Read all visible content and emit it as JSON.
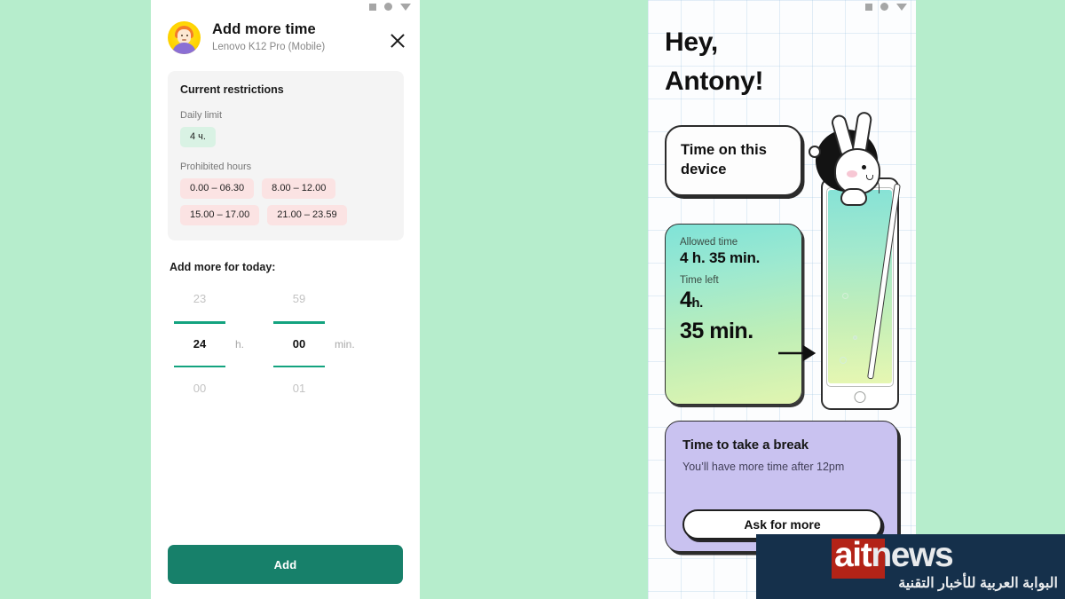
{
  "background_color": "#b6edcc",
  "left_panel": {
    "system_bar_icons": [
      "square-nav-icon",
      "circle-nav-icon",
      "triangle-back-icon"
    ],
    "avatar_name": "child-avatar",
    "title": "Add more time",
    "subtitle": "Lenovo K12 Pro (Mobile)",
    "close_icon": "close-icon",
    "restrictions": {
      "title": "Current restrictions",
      "daily_limit_label": "Daily limit",
      "daily_limit_value": "4 ч.",
      "prohibited_label": "Prohibited hours",
      "prohibited_hours": [
        "0.00 – 06.30",
        "8.00 – 12.00",
        "15.00 – 17.00",
        "21.00 – 23.59"
      ],
      "chip_green": "#d9f2e4",
      "chip_pink": "#fbe3e3"
    },
    "picker": {
      "section_label": "Add more for today:",
      "hours": {
        "above": "23",
        "value": "24",
        "below": "00",
        "unit": "h."
      },
      "minutes": {
        "above": "59",
        "value": "00",
        "below": "01",
        "unit": "min."
      },
      "rule_color": "#13a37f"
    },
    "add_button_label": "Add",
    "add_button_color": "#17806a"
  },
  "right_panel": {
    "system_bar_icons": [
      "square-nav-icon",
      "circle-nav-icon",
      "triangle-back-icon"
    ],
    "greeting_line1": "Hey,",
    "greeting_line2": "Antony!",
    "bubble_card_text": "Time on this device",
    "time_card": {
      "allowed_label": "Allowed time",
      "allowed_value": "4 h. 35 min.",
      "left_label": "Time left",
      "left_hours": "4",
      "left_hours_unit": "h.",
      "left_minutes": "35 min.",
      "gradient_from": "#7fe3d8",
      "gradient_to": "#e1f5b0"
    },
    "break_card": {
      "title": "Time to take a break",
      "subtitle": "You’ll have more time after 12pm",
      "button_label": "Ask for more",
      "card_color": "#c9c2f0"
    },
    "illustration_name": "bunny-drinking-phone-glass"
  },
  "watermark": {
    "logo_part1": "ait",
    "logo_part2": "news",
    "arabic_tagline": "البوابة العربية للأخبار التقنية",
    "background_color": "#15304b",
    "accent_color": "#b32317"
  }
}
